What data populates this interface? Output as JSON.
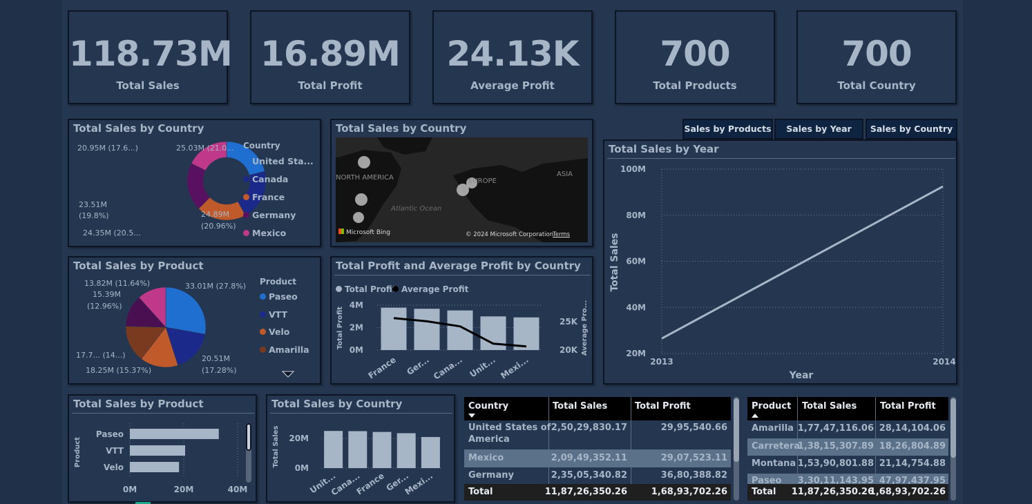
{
  "kpis": [
    {
      "value": "118.73M",
      "label": "Total Sales"
    },
    {
      "value": "16.89M",
      "label": "Total Profit"
    },
    {
      "value": "24.13K",
      "label": "Average Profit"
    },
    {
      "value": "700",
      "label": "Total Products"
    },
    {
      "value": "700",
      "label": "Total Country"
    }
  ],
  "nav": {
    "products": "Sales by Products",
    "year": "Sales by Year",
    "country": "Sales by Country"
  },
  "donut": {
    "title": "Total Sales by Country",
    "legend_title": "Country",
    "legend": [
      "United Sta...",
      "Canada",
      "France",
      "Germany",
      "Mexico"
    ],
    "colors": [
      "#1f6fd1",
      "#1b2a8a",
      "#c05a2a",
      "#5a1060",
      "#c0388a"
    ],
    "labels": {
      "tr": "25.03M (21.0...",
      "r1": "24.89M",
      "r2": "(20.96%)",
      "b": "24.35M (20.5...",
      "l1": "23.51M",
      "l2": "(19.8%)",
      "tl": "20.95M (17.6...)"
    }
  },
  "map": {
    "title": "Total Sales by Country",
    "na": "NORTH AMERICA",
    "eu": "EUROPE",
    "asia": "ASIA",
    "ocean": "Atlantic Ocean",
    "bing": "Microsoft Bing",
    "copyright": "© 2024 Microsoft Corporation",
    "terms": "Terms"
  },
  "line": {
    "title": "Total Sales by Year",
    "ylabel": "Total Sales",
    "xlabel": "Year",
    "yticks": [
      "100M",
      "80M",
      "60M",
      "40M",
      "20M"
    ],
    "xticks": [
      "2013",
      "2014"
    ]
  },
  "pie": {
    "title": "Total Sales by Product",
    "legend_title": "Product",
    "legend": [
      "Paseo",
      "VTT",
      "Velo",
      "Amarilla"
    ],
    "colors": [
      "#1f6fd1",
      "#1b2a8a",
      "#c05a2a",
      "#7a3a20",
      "#4a0f50",
      "#c0388a"
    ],
    "labels": {
      "tr": "33.01M (27.8%)",
      "r1": "20.51M",
      "r2": "(17.28%)",
      "b": "18.25M (15.37%)",
      "l": "17.7... (14...)",
      "tl1": "15.39M",
      "tl2": "(12.96%)",
      "t": "13.82M (11.64%)"
    }
  },
  "combo": {
    "title": "Total Profit and Average Profit by Country",
    "legend": [
      "Total Profit",
      "Average Profit"
    ],
    "yleft": [
      "4M",
      "2M",
      "0M"
    ],
    "yright": [
      "25K",
      "20K"
    ],
    "yleft_label": "Total Profit",
    "yright_label": "Average Pro...",
    "xticks": [
      "France",
      "Ger...",
      "Cana...",
      "Unit...",
      "Mexi..."
    ]
  },
  "hbar": {
    "title": "Total Sales by Product",
    "ylabel": "Product",
    "cats": [
      "Paseo",
      "VTT",
      "Velo"
    ],
    "xticks": [
      "0M",
      "20M",
      "40M"
    ]
  },
  "vbar": {
    "title": "Total Sales by Country",
    "ylabel": "Total Sales",
    "yticks": [
      "20M",
      "0M"
    ],
    "xticks": [
      "Unit...",
      "Cana...",
      "France",
      "Ger...",
      "Mexi..."
    ]
  },
  "table1": {
    "headers": [
      "Country",
      "Total Sales",
      "Total Profit"
    ],
    "rows": [
      [
        "United States of",
        "America",
        "2,50,29,830.17",
        "29,95,540.66"
      ],
      [
        "Mexico",
        "",
        "2,09,49,352.11",
        "29,07,523.11"
      ],
      [
        "Germany",
        "",
        "2,35,05,340.82",
        "36,80,388.82"
      ]
    ],
    "total": [
      "Total",
      "11,87,26,350.26",
      "1,68,93,702.26"
    ]
  },
  "table2": {
    "headers": [
      "Product",
      "Total Sales",
      "Total Profit"
    ],
    "rows": [
      [
        "Amarilla",
        "1,77,47,116.06",
        "28,14,104.06"
      ],
      [
        "Carretera",
        "1,38,15,307.89",
        "18,26,804.89"
      ],
      [
        "Montana",
        "1,53,90,801.88",
        "21,14,754.88"
      ],
      [
        "Paseo",
        "3,30,11,143.95",
        "47,97,437.95"
      ]
    ],
    "total": [
      "Total",
      "11,87,26,350.26",
      "1,68,93,702.26"
    ]
  },
  "chart_data": [
    {
      "type": "pie",
      "title": "Total Sales by Country",
      "categories": [
        "United States of America",
        "Canada",
        "France",
        "Germany",
        "Mexico"
      ],
      "values": [
        25.03,
        24.89,
        24.35,
        23.51,
        20.95
      ],
      "unit": "M"
    },
    {
      "type": "line",
      "title": "Total Sales by Year",
      "xlabel": "Year",
      "ylabel": "Total Sales",
      "x": [
        2013,
        2014
      ],
      "values": [
        26.5,
        92.5
      ],
      "ylim": [
        20,
        100
      ],
      "unit": "M",
      "grid": true
    },
    {
      "type": "pie",
      "title": "Total Sales by Product",
      "categories": [
        "Paseo",
        "VTT",
        "Velo",
        "Amarilla"
      ],
      "values": [
        33.01,
        20.51,
        18.25,
        17.7,
        15.39,
        13.82
      ],
      "unit": "M"
    },
    {
      "type": "bar",
      "title": "Total Profit and Average Profit by Country",
      "categories": [
        "France",
        "Ger...",
        "Cana...",
        "Unit...",
        "Mexi..."
      ],
      "series": [
        {
          "name": "Total Profit",
          "values": [
            3.78,
            3.68,
            3.53,
            3.0,
            2.91
          ],
          "unit": "M"
        },
        {
          "name": "Average Profit",
          "values": [
            27.0,
            26.3,
            25.2,
            21.4,
            20.8
          ],
          "unit": "K"
        }
      ],
      "ylim_left": [
        0,
        4
      ],
      "ylim_right": [
        20,
        25
      ]
    },
    {
      "type": "bar",
      "title": "Total Sales by Product",
      "orientation": "horizontal",
      "categories": [
        "Paseo",
        "VTT",
        "Velo"
      ],
      "values": [
        33.01,
        20.51,
        18.25
      ],
      "xlim": [
        0,
        40
      ],
      "unit": "M"
    },
    {
      "type": "bar",
      "title": "Total Sales by Country",
      "categories": [
        "Unit...",
        "Cana...",
        "France",
        "Ger...",
        "Mexi..."
      ],
      "values": [
        25.03,
        24.89,
        24.35,
        23.51,
        20.95
      ],
      "ylim": [
        0,
        30
      ],
      "unit": "M"
    }
  ]
}
